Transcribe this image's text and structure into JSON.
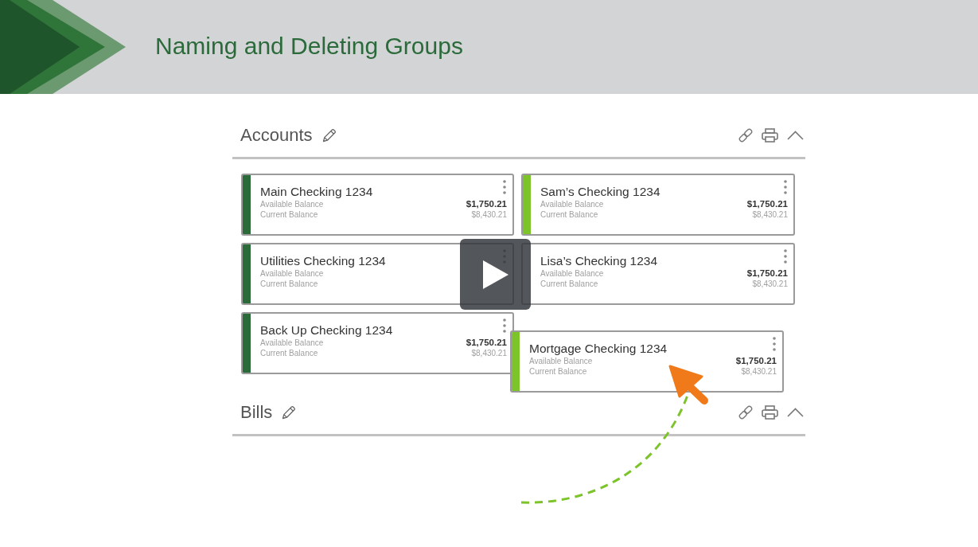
{
  "slide": {
    "title": "Naming and Deleting Groups"
  },
  "groups": [
    {
      "name": "Accounts",
      "accounts": [
        {
          "name": "Main Checking 1234",
          "available_label": "Available Balance",
          "available": "$1,750.21",
          "current_label": "Current Balance",
          "current": "$8,430.21",
          "color": "#2a6b39"
        },
        {
          "name": "Sam’s Checking 1234",
          "available_label": "Available Balance",
          "available": "$1,750.21",
          "current_label": "Current Balance",
          "current": "$8,430.21",
          "color": "#7dc42b"
        },
        {
          "name": "Utilities Checking 1234",
          "available_label": "Available Balance",
          "current_label": "Current Balance",
          "color": "#2a6b39"
        },
        {
          "name": "Lisa’s Checking 1234",
          "available_label": "Available Balance",
          "available": "$1,750.21",
          "current_label": "Current Balance",
          "current": "$8,430.21"
        },
        {
          "name": "Back Up Checking 1234",
          "available_label": "Available Balance",
          "available": "$1,750.21",
          "current_label": "Current Balance",
          "current": "$8,430.21",
          "color": "#2a6b39"
        }
      ]
    },
    {
      "name": "Bills"
    }
  ],
  "dragged_card": {
    "name": "Mortgage Checking 1234",
    "available_label": "Available Balance",
    "available": "$1,750.21",
    "current_label": "Current Balance",
    "current": "$8,430.21",
    "color": "#7dc42b"
  }
}
